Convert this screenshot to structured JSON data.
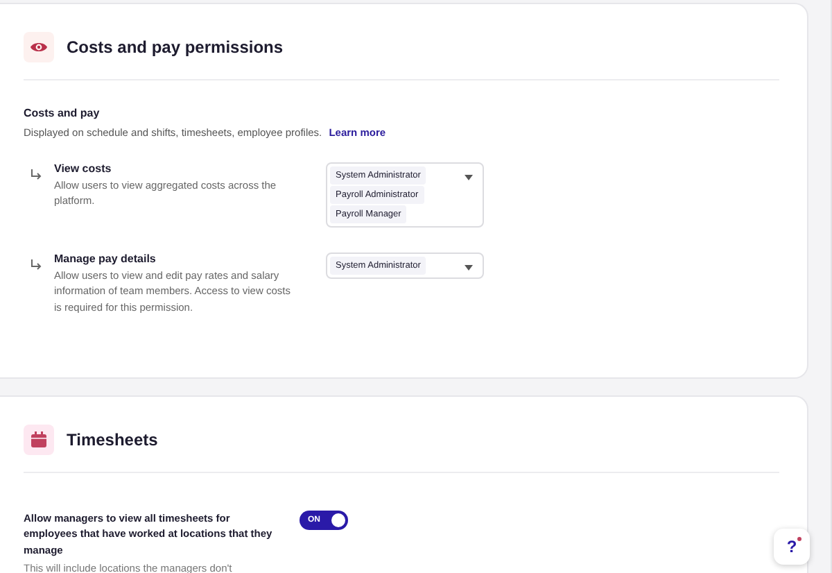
{
  "cost_section": {
    "title": "Costs and pay permissions",
    "group_title": "Costs and pay",
    "group_description": "Displayed on schedule and shifts, timesheets, employee profiles.",
    "learn_more": "Learn more",
    "permissions": [
      {
        "title": "View costs",
        "description": "Allow users to view aggregated costs across the platform.",
        "roles": [
          "System Administrator",
          "Payroll Administrator",
          "Payroll Manager"
        ]
      },
      {
        "title": "Manage pay details",
        "description": "Allow users to view and edit pay rates and salary information of team members. Access to view costs is required for this permission.",
        "roles": [
          "System Administrator"
        ]
      }
    ]
  },
  "timesheets_section": {
    "title": "Timesheets",
    "setting": {
      "title": "Allow managers to view all timesheets for employees that have worked at locations that they manage",
      "description": "This will include locations the managers don't",
      "on": true,
      "toggle_label": "ON"
    }
  },
  "help_button": {
    "label": "?",
    "notification": true
  }
}
